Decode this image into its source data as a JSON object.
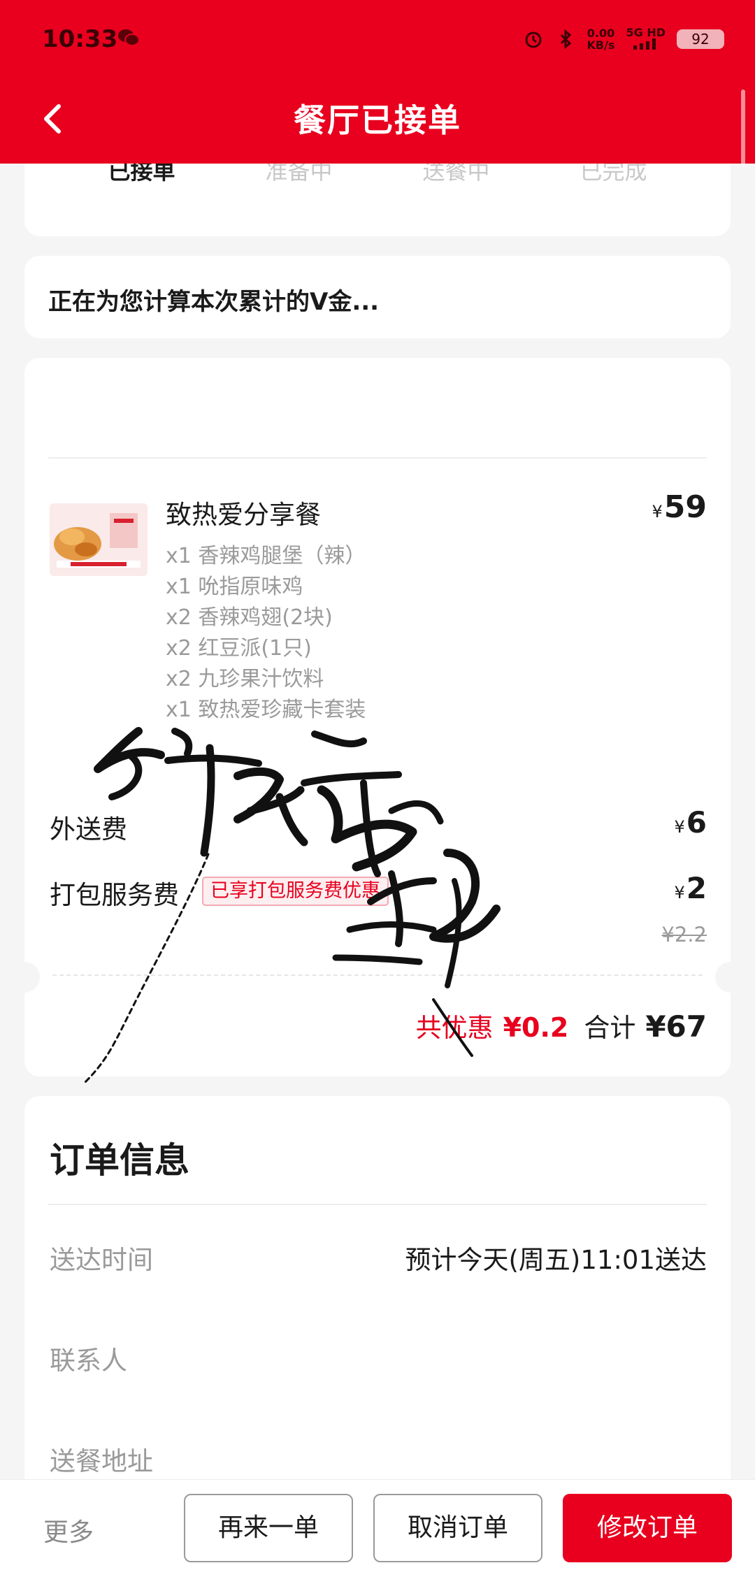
{
  "status_bar": {
    "time": "10:33",
    "network_speed": "0.00",
    "network_unit": "KB/s",
    "network_type": "5G HD",
    "battery": "92"
  },
  "nav": {
    "title": "餐厅已接单"
  },
  "progress": {
    "steps": [
      "已接单",
      "准备中",
      "送餐中",
      "已完成"
    ]
  },
  "vgold": {
    "text": "正在为您计算本次累计的V金..."
  },
  "order": {
    "product": {
      "name": "致热爱分享餐",
      "currency": "¥",
      "price": "59",
      "items": [
        "x1 香辣鸡腿堡（辣）",
        "x1 吮指原味鸡",
        "x2 香辣鸡翅(2块)",
        "x2 红豆派(1只)",
        "x2 九珍果汁饮料",
        "x1 致热爱珍藏卡套装"
      ]
    },
    "delivery_fee": {
      "label": "外送费",
      "currency": "¥",
      "price": "6"
    },
    "packing_fee": {
      "label": "打包服务费",
      "badge": "已享打包服务费优惠",
      "currency": "¥",
      "price": "2",
      "original_price": "¥2.2"
    },
    "summary": {
      "discount_label": "共优惠",
      "discount_value": "¥0.2",
      "total_label": "合计",
      "total_value": "¥67"
    }
  },
  "order_info": {
    "title": "订单信息",
    "rows": [
      {
        "label": "送达时间",
        "value": "预计今天(周五)11:01送达"
      },
      {
        "label": "联系人",
        "value": ""
      },
      {
        "label": "送餐地址",
        "value": ""
      }
    ]
  },
  "bottom_bar": {
    "more": "更多",
    "reorder": "再来一单",
    "cancel": "取消订单",
    "modify": "修改订单"
  },
  "colors": {
    "brand_red": "#e8001e",
    "text_gray": "#9a9a9a"
  }
}
